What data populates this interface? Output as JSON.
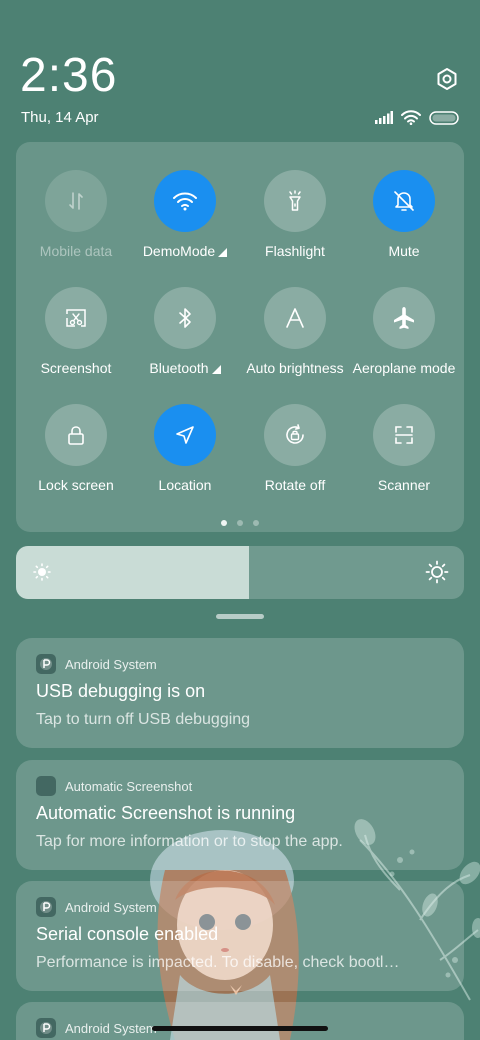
{
  "status": {
    "time": "2:36",
    "date": "Thu, 14 Apr"
  },
  "icons": {
    "settings": "settings-hexagon-icon",
    "signal": "cellular-signal-icon",
    "wifi": "wifi-icon",
    "battery": "battery-icon"
  },
  "quick_settings": {
    "tiles": [
      {
        "label": "Mobile data",
        "state": "disabled",
        "icon": "mobile-data-icon"
      },
      {
        "label": "DemoMode",
        "state": "on",
        "icon": "wifi-icon"
      },
      {
        "label": "Flashlight",
        "state": "off",
        "icon": "flashlight-icon"
      },
      {
        "label": "Mute",
        "state": "on",
        "icon": "bell-muted-icon"
      },
      {
        "label": "Screenshot",
        "state": "off",
        "icon": "screenshot-icon"
      },
      {
        "label": "Bluetooth",
        "state": "off",
        "icon": "bluetooth-icon"
      },
      {
        "label": "Auto brightness",
        "state": "off",
        "icon": "auto-brightness-icon"
      },
      {
        "label": "Aeroplane mode",
        "state": "off",
        "icon": "airplane-icon"
      },
      {
        "label": "Lock screen",
        "state": "off",
        "icon": "lock-icon"
      },
      {
        "label": "Location",
        "state": "on",
        "icon": "location-arrow-icon"
      },
      {
        "label": "Rotate off",
        "state": "off",
        "icon": "rotate-lock-icon"
      },
      {
        "label": "Scanner",
        "state": "off",
        "icon": "scanner-icon"
      }
    ],
    "page_count": 3,
    "active_page": 1
  },
  "brightness": {
    "level": 0.52
  },
  "notifications": [
    {
      "app": "Android System",
      "title": "USB debugging is on",
      "body": "Tap to turn off USB debugging"
    },
    {
      "app": "Automatic Screenshot",
      "title": "Automatic Screenshot is running",
      "body": "Tap for more information or to stop the app."
    },
    {
      "app": "Android System",
      "title": "Serial console enabled",
      "body": "Performance is impacted. To disable, check bootl…"
    },
    {
      "app": "Android System",
      "title": "",
      "body": ""
    }
  ],
  "colors": {
    "background": "#4d8173",
    "accent_on": "#1a8ff0"
  }
}
